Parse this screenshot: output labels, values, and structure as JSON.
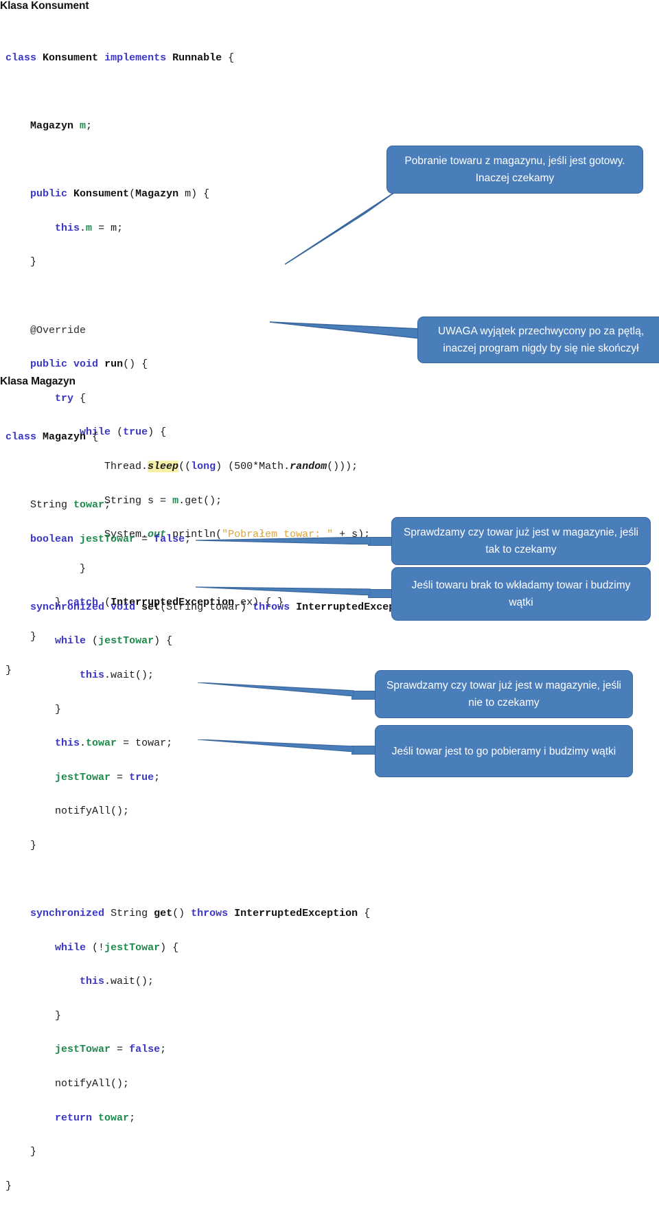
{
  "document": {
    "sections": [
      {
        "heading": "Klasa Konsument"
      },
      {
        "heading": "Klasa Magazyn"
      }
    ]
  },
  "code_konsument": {
    "language": "java",
    "lines": [
      "class Konsument implements Runnable {",
      "",
      "    Magazyn m;",
      "",
      "    public Konsument(Magazyn m) {",
      "        this.m = m;",
      "    }",
      "",
      "    @Override",
      "    public void run() {",
      "        try {",
      "            while (true) {",
      "                Thread.sleep((long) (500*Math.random()));",
      "                String s = m.get();",
      "                System.out.println(\"Pobrałem towar: \" + s);",
      "            }",
      "        } catch (InterruptedException ex) { }",
      "    }",
      "}"
    ]
  },
  "code_magazyn": {
    "language": "java",
    "lines": [
      "class Magazyn {",
      "",
      "    String towar;",
      "    boolean jestTowar = false;",
      "",
      "    synchronized void set(String towar) throws InterruptedException {",
      "        while (jestTowar) {",
      "            this.wait();",
      "        }",
      "        this.towar = towar;",
      "        jestTowar = true;",
      "        notifyAll();",
      "    }",
      "",
      "    synchronized String get() throws InterruptedException {",
      "        while (!jestTowar) {",
      "            this.wait();",
      "        }",
      "        jestTowar = false;",
      "        notifyAll();",
      "        return towar;",
      "    }",
      "}"
    ]
  },
  "callouts": [
    {
      "id": "callout-1",
      "text": "Pobranie towaru z magazynu, jeśli jest gotowy. Inaczej czekamy"
    },
    {
      "id": "callout-2",
      "text": "UWAGA wyjątek przechwycony  po za pętlą, inaczej program nigdy by się nie skończył"
    },
    {
      "id": "callout-3",
      "text": "Sprawdzamy czy towar już jest w magazynie, jeśli tak to czekamy"
    },
    {
      "id": "callout-4",
      "text": "Jeśli towaru brak to wkładamy towar i budzimy wątki"
    },
    {
      "id": "callout-5",
      "text": "Sprawdzamy czy towar już jest w magazynie, jeśli nie to czekamy"
    },
    {
      "id": "callout-6",
      "text": "Jeśli towar jest to go pobieramy i budzimy wątki"
    }
  ],
  "colors": {
    "callout_fill": "#4a7ebb",
    "callout_border": "#3a679e",
    "keyword": "#3a36c8",
    "field": "#1f8a4c",
    "string": "#d9a441",
    "highlight": "#f7f1a8",
    "text": "#1a1a1a"
  }
}
